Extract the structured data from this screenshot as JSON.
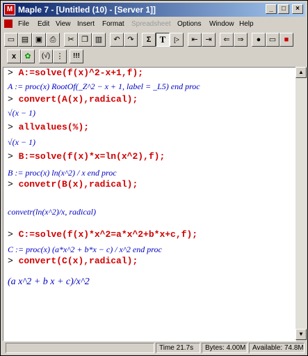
{
  "window": {
    "title": "Maple 7 - [Untitled (10) - [Server 1]]",
    "icon": "maple-leaf-icon"
  },
  "menu": {
    "items": [
      {
        "label": "File",
        "enabled": true
      },
      {
        "label": "Edit",
        "enabled": true
      },
      {
        "label": "View",
        "enabled": true
      },
      {
        "label": "Insert",
        "enabled": true
      },
      {
        "label": "Format",
        "enabled": true
      },
      {
        "label": "Spreadsheet",
        "enabled": false
      },
      {
        "label": "Options",
        "enabled": true
      },
      {
        "label": "Window",
        "enabled": true
      },
      {
        "label": "Help",
        "enabled": true
      }
    ]
  },
  "toolbar": {
    "sigma_label": "Σ",
    "text_label": "T",
    "prompt_label": "[>",
    "exec_label": "!!!"
  },
  "worksheet": {
    "prompt": ">",
    "lines": [
      {
        "kind": "input",
        "text": "A:=solve(f(x)^2-x+1,f);"
      },
      {
        "kind": "output",
        "text": "A := proc(x) RootOf(_Z^2 − x + 1, label = _L5) end proc"
      },
      {
        "kind": "input",
        "text": "convert(A(x),radical);"
      },
      {
        "kind": "output",
        "text": "√(x − 1)"
      },
      {
        "kind": "input",
        "text": "allvalues(%);"
      },
      {
        "kind": "output",
        "text": "√(x − 1)"
      },
      {
        "kind": "input",
        "text": "B:=solve(f(x)*x=ln(x^2),f);"
      },
      {
        "kind": "output",
        "text": "B := proc(x) ln(x^2) / x end proc"
      },
      {
        "kind": "input",
        "text": "convetr(B(x),radical);"
      },
      {
        "kind": "output",
        "text": "convetr(ln(x^2)/x, radical)"
      },
      {
        "kind": "input",
        "text": "C:=solve(f(x)*x^2=a*x^2+b*x+c,f);"
      },
      {
        "kind": "output",
        "text": "C := proc(x) (a*x^2 + b*x − c) / x^2 end proc"
      },
      {
        "kind": "input",
        "text": "convert(C(x),radical);"
      },
      {
        "kind": "output",
        "text": "(a x^2 + b x + c)/x^2"
      }
    ]
  },
  "status": {
    "time": "Time 21.7s",
    "bytes": "Bytes: 4.00M",
    "available": "Available: 74.8M"
  }
}
